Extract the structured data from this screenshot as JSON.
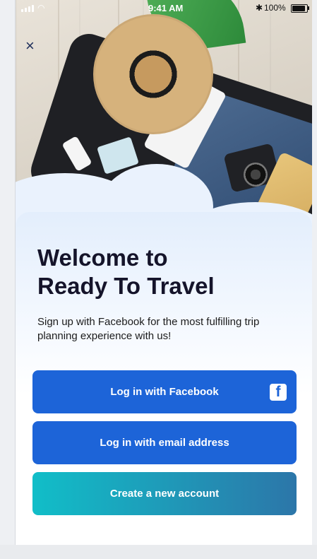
{
  "status": {
    "time": "9:41 AM",
    "battery": "100%",
    "bluetooth_icon": "bluetooth-icon"
  },
  "hero": {
    "title_line_1": "Welcome to",
    "title_line_2": "Ready To Travel",
    "subtitle": "Sign up with Facebook for the most fulfilling trip planning experience with us!"
  },
  "actions": {
    "facebook_label": "Log in with Facebook",
    "email_label": "Log in with email address",
    "create_label": "Create a new account"
  },
  "icons": {
    "close": "close-icon",
    "facebook": "facebook-icon"
  },
  "colors": {
    "primary_blue": "#1d64d8",
    "create_start": "#11bec8",
    "create_end": "#2c76a9",
    "title_text": "#15142a"
  }
}
